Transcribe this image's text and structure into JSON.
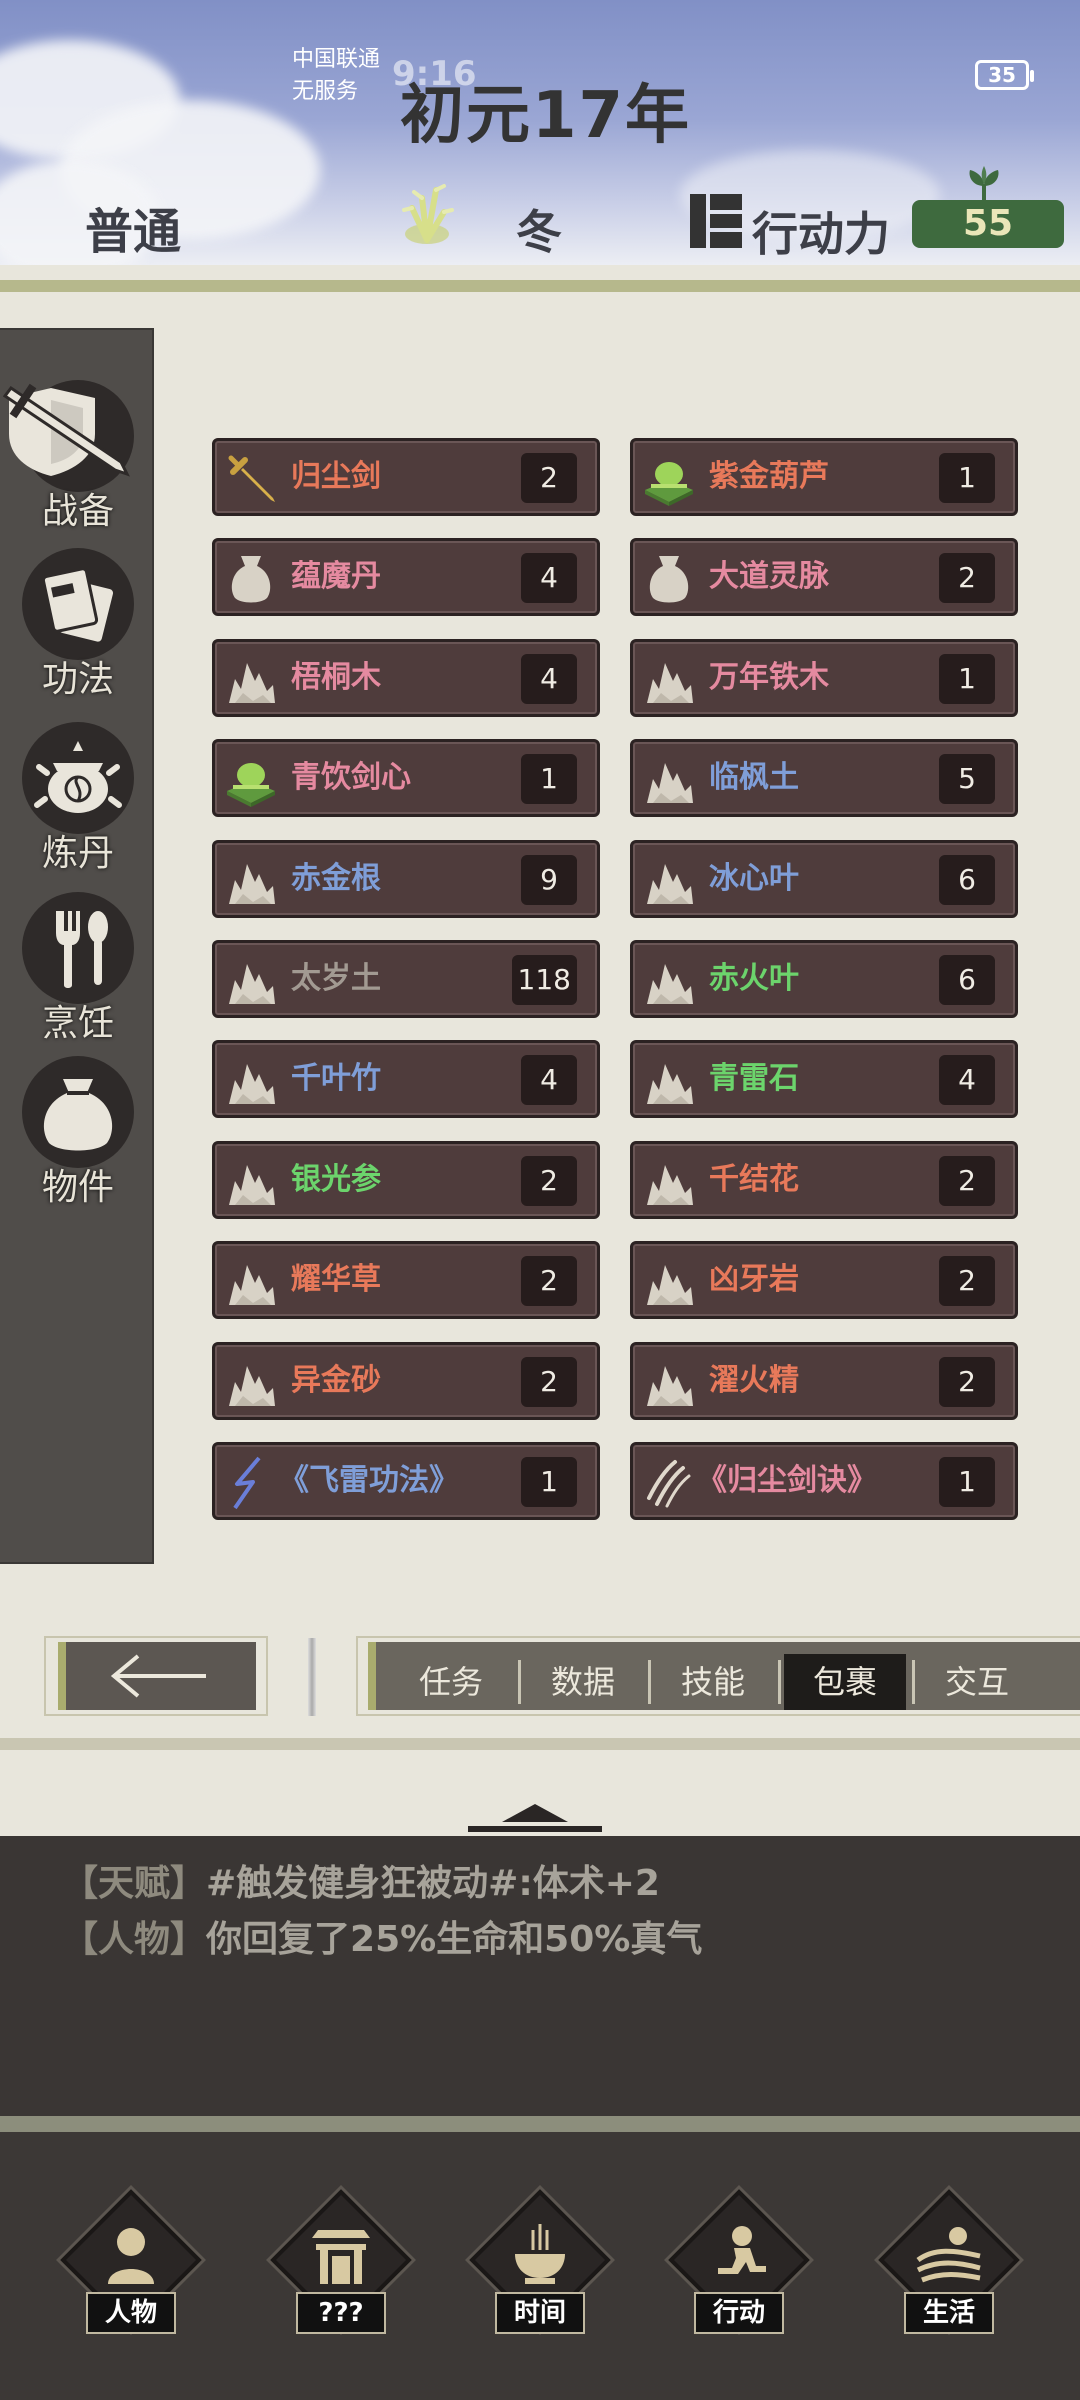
{
  "status_bar": {
    "carrier_line1": "中国联通",
    "carrier_line2": "无服务",
    "time": "9:16",
    "battery": "35"
  },
  "header": {
    "title": "初元17年",
    "difficulty": "普通",
    "season": "冬",
    "action_label": "行动力",
    "action_points": "55"
  },
  "sidebar": {
    "items": [
      {
        "label": "战备",
        "icon": "sword-shield-icon"
      },
      {
        "label": "功法",
        "icon": "scroll-cards-icon"
      },
      {
        "label": "炼丹",
        "icon": "alchemy-cauldron-icon"
      },
      {
        "label": "烹饪",
        "icon": "utensils-icon"
      },
      {
        "label": "物件",
        "icon": "item-bag-icon"
      }
    ]
  },
  "inventory": {
    "items": [
      {
        "name": "归尘剑",
        "count": "2",
        "color": "#e8795a",
        "icon": "sword-icon"
      },
      {
        "name": "紫金葫芦",
        "count": "1",
        "color": "#e8795a",
        "icon": "green-gourd-icon"
      },
      {
        "name": "蕴魔丹",
        "count": "4",
        "color": "#e58aa0",
        "icon": "pouch-icon"
      },
      {
        "name": "大道灵脉",
        "count": "2",
        "color": "#e58aa0",
        "icon": "pouch-icon"
      },
      {
        "name": "梧桐木",
        "count": "4",
        "color": "#e58aa0",
        "icon": "material-icon"
      },
      {
        "name": "万年铁木",
        "count": "1",
        "color": "#e58aa0",
        "icon": "material-icon"
      },
      {
        "name": "青饮剑心",
        "count": "1",
        "color": "#e58aa0",
        "icon": "green-gourd-icon"
      },
      {
        "name": "临枫土",
        "count": "5",
        "color": "#7f9ed8",
        "icon": "material-icon"
      },
      {
        "name": "赤金根",
        "count": "9",
        "color": "#7f9ed8",
        "icon": "material-icon"
      },
      {
        "name": "冰心叶",
        "count": "6",
        "color": "#7f9ed8",
        "icon": "material-icon"
      },
      {
        "name": "太岁土",
        "count": "118",
        "color": "#a29a92",
        "icon": "material-icon"
      },
      {
        "name": "赤火叶",
        "count": "6",
        "color": "#6cd46c",
        "icon": "material-icon"
      },
      {
        "name": "千叶竹",
        "count": "4",
        "color": "#7f9ed8",
        "icon": "material-icon"
      },
      {
        "name": "青雷石",
        "count": "4",
        "color": "#6cd46c",
        "icon": "material-icon"
      },
      {
        "name": "银光参",
        "count": "2",
        "color": "#6cd46c",
        "icon": "material-icon"
      },
      {
        "name": "千结花",
        "count": "2",
        "color": "#e8795a",
        "icon": "material-icon"
      },
      {
        "name": "耀华草",
        "count": "2",
        "color": "#e8795a",
        "icon": "material-icon"
      },
      {
        "name": "凶牙岩",
        "count": "2",
        "color": "#e8795a",
        "icon": "material-icon"
      },
      {
        "name": "异金砂",
        "count": "2",
        "color": "#e8795a",
        "icon": "material-icon"
      },
      {
        "name": "濯火精",
        "count": "2",
        "color": "#e8795a",
        "icon": "material-icon"
      },
      {
        "name": "《飞雷功法》",
        "count": "1",
        "color": "#7f9ed8",
        "icon": "lightning-icon"
      },
      {
        "name": "《归尘剑诀》",
        "count": "1",
        "color": "#e58aa0",
        "icon": "claw-slash-icon"
      }
    ]
  },
  "tabs": {
    "back_icon": "arrow-left-icon",
    "items": [
      "任务",
      "数据",
      "技能",
      "包裹",
      "交互"
    ],
    "active": "包裹"
  },
  "log": {
    "lines": [
      {
        "tag": "【天赋】",
        "text": "#触发健身狂被动#:体术+2"
      },
      {
        "tag": "【人物】",
        "text": "你回复了25%生命和50%真气"
      }
    ]
  },
  "bottom_nav": {
    "items": [
      {
        "label": "人物",
        "icon": "person-icon"
      },
      {
        "label": "???",
        "icon": "gate-icon"
      },
      {
        "label": "时间",
        "icon": "incense-burner-icon"
      },
      {
        "label": "行动",
        "icon": "running-person-icon"
      },
      {
        "label": "生活",
        "icon": "sunset-field-icon"
      }
    ]
  },
  "colors": {
    "item_bg": "#4f3c3c",
    "sidebar_bg": "#504d4a",
    "action_badge": "#3e6a3e",
    "name_orange": "#e8795a",
    "name_pink": "#e58aa0",
    "name_blue": "#7f9ed8",
    "name_green": "#6cd46c",
    "name_gray": "#a29a92"
  }
}
